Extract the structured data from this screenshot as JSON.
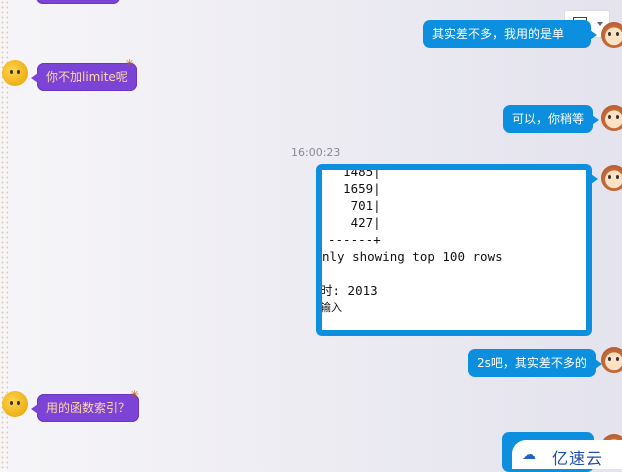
{
  "messages": [
    {
      "side": "right",
      "text": "其实差不多，我用的是单"
    },
    {
      "side": "left",
      "text": "你不加limite呢"
    },
    {
      "side": "right",
      "text": "可以，你稍等"
    },
    {
      "side": "right",
      "text": "2s吧，其实差不多的"
    },
    {
      "side": "left",
      "text": "用的函数索引？"
    }
  ],
  "timestamp": "16:00:23",
  "screenshot": {
    "lines": [
      "  1485|",
      "  1659|",
      "   701|",
      "   427|",
      "------+",
      "nly showing top 100 rows",
      "",
      "时: 2013",
      "输入"
    ]
  },
  "watermark": {
    "logo": "亿速云"
  },
  "icons": {
    "image_picker": "image-icon"
  }
}
